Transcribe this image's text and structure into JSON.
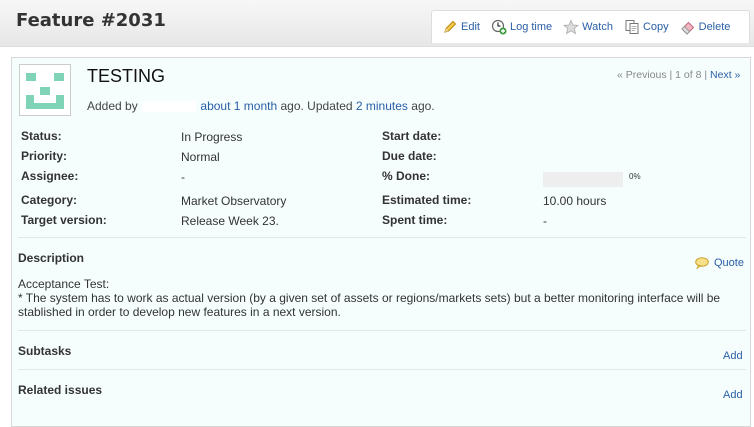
{
  "header": {
    "title": "Feature #2031"
  },
  "toolbar": {
    "edit_label": "Edit",
    "log_time_label": "Log time",
    "watch_label": "Watch",
    "copy_label": "Copy",
    "delete_label": "Delete"
  },
  "issue": {
    "subject": "TESTING",
    "added_by_prefix": "Added by",
    "added_ago": "about 1 month",
    "ago_updated": "ago. Updated",
    "updated_ago": "2 minutes",
    "ago_end": "ago.",
    "nav": {
      "previous": "« Previous",
      "position": "1 of 8",
      "next": "Next »"
    },
    "attributes": {
      "status": {
        "label": "Status:",
        "value": "In Progress"
      },
      "priority": {
        "label": "Priority:",
        "value": "Normal"
      },
      "assignee": {
        "label": "Assignee:",
        "value": "-"
      },
      "category": {
        "label": "Category:",
        "value": "Market Observatory"
      },
      "target_version": {
        "label": "Target version:",
        "value": "Release Week 23."
      },
      "start_date": {
        "label": "Start date:",
        "value": ""
      },
      "due_date": {
        "label": "Due date:",
        "value": ""
      },
      "done": {
        "label": "% Done:",
        "value_text": "0%",
        "percent": 0
      },
      "estimated_time": {
        "label": "Estimated time:",
        "value": "10.00 hours"
      },
      "spent_time": {
        "label": "Spent time:",
        "value": "-"
      }
    },
    "description": {
      "title": "Description",
      "quote_label": "Quote",
      "line1": "Acceptance Test:",
      "line2": "* The system has to work as actual version (by a given set of assets or regions/markets sets) but a better monitoring interface will be stablished in order to develop new features in a next version."
    },
    "subtasks": {
      "title": "Subtasks",
      "add_label": "Add"
    },
    "related": {
      "title": "Related issues",
      "add_label": "Add"
    }
  },
  "colors": {
    "link": "#2a5fa6",
    "issue_background": "#f5fdfd",
    "avatar_accent": "#7fd3b6",
    "progress_track": "#eeeeee"
  }
}
